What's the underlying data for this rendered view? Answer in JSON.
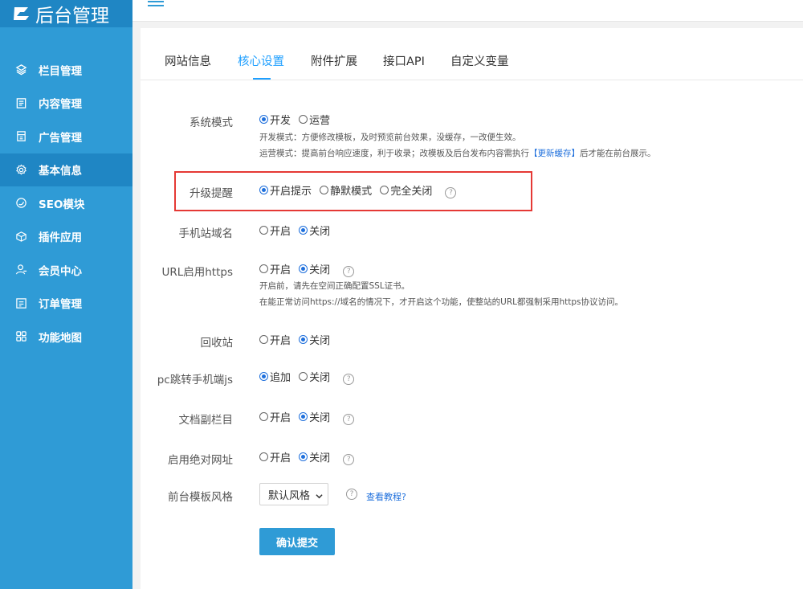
{
  "app": {
    "logo_text": "后台管理"
  },
  "sidebar": {
    "items": [
      {
        "label": "栏目管理",
        "icon": "layers-icon"
      },
      {
        "label": "内容管理",
        "icon": "document-icon"
      },
      {
        "label": "广告管理",
        "icon": "ad-icon"
      },
      {
        "label": "基本信息",
        "icon": "gear-icon",
        "active": true
      },
      {
        "label": "SEO模块",
        "icon": "seo-icon"
      },
      {
        "label": "插件应用",
        "icon": "plugin-icon"
      },
      {
        "label": "会员中心",
        "icon": "user-icon"
      },
      {
        "label": "订单管理",
        "icon": "order-icon"
      },
      {
        "label": "功能地图",
        "icon": "grid-icon"
      }
    ]
  },
  "tabs": [
    {
      "label": "网站信息"
    },
    {
      "label": "核心设置",
      "active": true
    },
    {
      "label": "附件扩展"
    },
    {
      "label": "接口API"
    },
    {
      "label": "自定义变量"
    }
  ],
  "form": {
    "system_mode": {
      "label": "系统模式",
      "opt1": "开发",
      "opt2": "运营",
      "selected": "开发",
      "note1": "开发模式：方便修改模板，及时预览前台效果，没缓存，一改便生效。",
      "note2_pre": "运营模式：提高前台响应速度，利于收录；改模板及后台发布内容需执行",
      "note2_link": "【更新缓存】",
      "note2_post": "后才能在前台展示。"
    },
    "upgrade_reminder": {
      "label": "升级提醒",
      "opt1": "开启提示",
      "opt2": "静默模式",
      "opt3": "完全关闭",
      "selected": "开启提示"
    },
    "mobile_domain": {
      "label": "手机站域名",
      "opt1": "开启",
      "opt2": "关闭",
      "selected": "关闭"
    },
    "https": {
      "label": "URL启用https",
      "opt1": "开启",
      "opt2": "关闭",
      "selected": "关闭",
      "note1": "开启前，请先在空间正确配置SSL证书。",
      "note2": "在能正常访问https://域名的情况下，才开启这个功能，使整站的URL都强制采用https协议访问。"
    },
    "recycle": {
      "label": "回收站",
      "opt1": "开启",
      "opt2": "关闭",
      "selected": "关闭"
    },
    "pc_redirect": {
      "label": "pc跳转手机端js",
      "opt1": "追加",
      "opt2": "关闭",
      "selected": "追加"
    },
    "sub_column": {
      "label": "文档副栏目",
      "opt1": "开启",
      "opt2": "关闭",
      "selected": "关闭"
    },
    "absolute_url": {
      "label": "启用绝对网址",
      "opt1": "开启",
      "opt2": "关闭",
      "selected": "关闭"
    },
    "template_style": {
      "label": "前台模板风格",
      "value": "默认风格",
      "tutorial": "查看教程?"
    },
    "submit_label": "确认提交"
  },
  "help_glyph": "?"
}
